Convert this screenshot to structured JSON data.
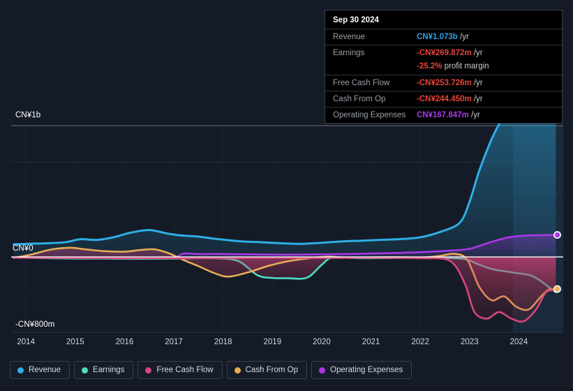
{
  "axes": {
    "y_top_label": "CN¥1b",
    "y_zero_label": "CN¥0",
    "y_bottom_label": "-CN¥800m"
  },
  "tooltip": {
    "title": "Sep 30 2024",
    "rows": [
      {
        "key": "Revenue",
        "amount": "CN¥1.073b",
        "unit": "/yr",
        "color": "#2e9fe0"
      },
      {
        "key": "Earnings",
        "amount": "-CN¥269.872m",
        "unit": "/yr",
        "color": "#e8453c"
      },
      {
        "key": "",
        "amount": "-25.2%",
        "unit": "profit margin",
        "color": "#e8453c"
      },
      {
        "key": "Free Cash Flow",
        "amount": "-CN¥253.726m",
        "unit": "/yr",
        "color": "#e8453c"
      },
      {
        "key": "Cash From Op",
        "amount": "-CN¥244.450m",
        "unit": "/yr",
        "color": "#e8453c"
      },
      {
        "key": "Operating Expenses",
        "amount": "CN¥167.847m",
        "unit": "/yr",
        "color": "#a93ce8"
      }
    ]
  },
  "legend": {
    "items": [
      {
        "label": "Revenue",
        "color": "#2eafe6"
      },
      {
        "label": "Earnings",
        "color": "#4ddcc4"
      },
      {
        "label": "Free Cash Flow",
        "color": "#d6457f"
      },
      {
        "label": "Cash From Op",
        "color": "#e8ad55"
      },
      {
        "label": "Operating Expenses",
        "color": "#ab37e8"
      }
    ]
  },
  "chart_data": {
    "type": "area",
    "title": "",
    "xlabel": "",
    "ylabel": "CN¥",
    "currency": "CN¥",
    "xlim": [
      2013.7,
      2024.9
    ],
    "ylim": [
      -800000000,
      1000000000
    ],
    "ytick_values": [
      1000000000,
      0,
      -800000000
    ],
    "ytick_labels": [
      "CN¥1b",
      "CN¥0",
      "-CN¥800m"
    ],
    "grid": true,
    "legend_position": "bottom",
    "categories": [
      2014,
      2015,
      2016,
      2017,
      2018,
      2019,
      2020,
      2021,
      2022,
      2023,
      2024
    ],
    "forecast_band_start": 2023.55,
    "series": [
      {
        "name": "Revenue",
        "color": "#2eafe6",
        "x": [
          2013.75,
          2014.0,
          2014.4,
          2014.8,
          2015.1,
          2015.45,
          2015.8,
          2016.1,
          2016.5,
          2016.9,
          2017.2,
          2017.5,
          2017.8,
          2018.1,
          2018.4,
          2018.8,
          2019.2,
          2019.6,
          2020.0,
          2020.4,
          2020.8,
          2021.2,
          2021.6,
          2022.0,
          2022.4,
          2022.8,
          2023.0,
          2023.2,
          2023.5,
          2023.8,
          2024.05,
          2024.45,
          2024.75
        ],
        "values": [
          96000000,
          100000000,
          104000000,
          112000000,
          135000000,
          130000000,
          152000000,
          183000000,
          205000000,
          176000000,
          162000000,
          155000000,
          140000000,
          128000000,
          118000000,
          112000000,
          104000000,
          100000000,
          108000000,
          118000000,
          124000000,
          130000000,
          136000000,
          150000000,
          190000000,
          260000000,
          420000000,
          660000000,
          940000000,
          1120000000,
          1140000000,
          1130000000,
          1073000000
        ]
      },
      {
        "name": "Earnings",
        "color": "#4ddcc4",
        "x": [
          2013.75,
          2014.2,
          2014.8,
          2015.4,
          2016.0,
          2016.6,
          2017.2,
          2017.8,
          2018.3,
          2018.7,
          2019.0,
          2019.3,
          2019.7,
          2020.0,
          2020.2,
          2020.6,
          2021.0,
          2021.5,
          2022.0,
          2022.5,
          2022.9,
          2023.2,
          2023.5,
          2023.9,
          2024.3,
          2024.75
        ],
        "values": [
          -4000000,
          -8000000,
          -12000000,
          -12000000,
          -14000000,
          -14000000,
          -12000000,
          -10000000,
          -30000000,
          -140000000,
          -160000000,
          -162000000,
          -158000000,
          -60000000,
          -6000000,
          -8000000,
          -10000000,
          -8000000,
          -6000000,
          -8000000,
          -16000000,
          -60000000,
          -96000000,
          -120000000,
          -150000000,
          -269872000
        ]
      },
      {
        "name": "Free Cash Flow",
        "color": "#d6457f",
        "x": [
          2013.75,
          2015.0,
          2016.5,
          2018.0,
          2019.0,
          2020.0,
          2021.0,
          2022.0,
          2022.6,
          2022.9,
          2023.1,
          2023.35,
          2023.6,
          2023.85,
          2024.1,
          2024.35,
          2024.55,
          2024.75
        ],
        "values": [
          -6000000,
          -8000000,
          -10000000,
          -8000000,
          -6000000,
          -8000000,
          -6000000,
          -10000000,
          -30000000,
          -200000000,
          -420000000,
          -470000000,
          -420000000,
          -470000000,
          -490000000,
          -400000000,
          -270000000,
          -253726000
        ]
      },
      {
        "name": "Cash From Op",
        "color": "#e8ad55",
        "x": [
          2013.75,
          2014.1,
          2014.5,
          2014.9,
          2015.2,
          2015.6,
          2016.0,
          2016.3,
          2016.6,
          2016.9,
          2017.2,
          2017.5,
          2017.8,
          2018.1,
          2018.5,
          2018.9,
          2019.3,
          2019.7,
          2020.1,
          2020.5,
          2021.0,
          2021.5,
          2022.0,
          2022.4,
          2022.7,
          2022.95,
          2023.2,
          2023.45,
          2023.7,
          2023.95,
          2024.2,
          2024.45,
          2024.6,
          2024.75
        ],
        "values": [
          -8000000,
          18000000,
          56000000,
          70000000,
          58000000,
          44000000,
          40000000,
          52000000,
          58000000,
          28000000,
          -24000000,
          -70000000,
          -120000000,
          -150000000,
          -118000000,
          -70000000,
          -34000000,
          -12000000,
          2000000,
          -6000000,
          -4000000,
          -2000000,
          -6000000,
          8000000,
          24000000,
          -20000000,
          -230000000,
          -330000000,
          -300000000,
          -380000000,
          -400000000,
          -300000000,
          -250000000,
          -244450000
        ]
      },
      {
        "name": "Operating Expenses",
        "color": "#ab37e8",
        "x": [
          2017.05,
          2017.2,
          2017.5,
          2018.0,
          2018.5,
          2019.0,
          2019.5,
          2020.0,
          2020.5,
          2021.0,
          2021.5,
          2022.0,
          2022.5,
          2023.0,
          2023.4,
          2023.8,
          2024.2,
          2024.75
        ],
        "values": [
          -6000000,
          26000000,
          22000000,
          22000000,
          20000000,
          18000000,
          18000000,
          20000000,
          22000000,
          26000000,
          30000000,
          36000000,
          46000000,
          62000000,
          110000000,
          150000000,
          164000000,
          167847000
        ]
      }
    ],
    "endpoint_markers": [
      {
        "series": "Revenue",
        "value": 1073000000
      },
      {
        "series": "Operating Expenses",
        "value": 167847000
      },
      {
        "series": "Cash From Op",
        "value": -244450000
      }
    ]
  }
}
